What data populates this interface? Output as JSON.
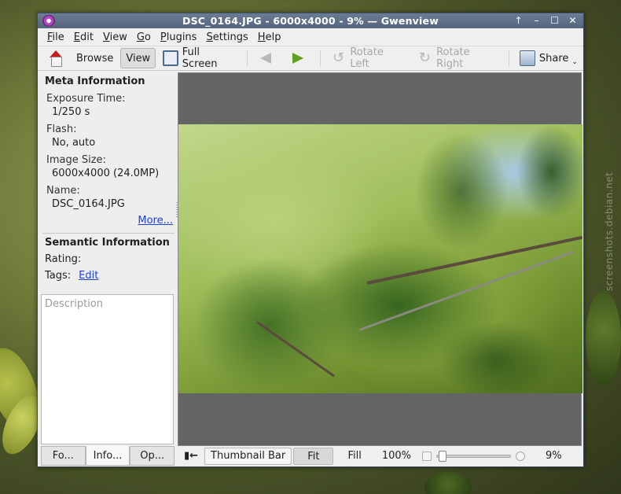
{
  "window": {
    "title": "DSC_0164.JPG - 6000x4000 - 9%  — Gwenview"
  },
  "menubar": {
    "items": [
      {
        "u": "F",
        "rest": "ile"
      },
      {
        "u": "E",
        "rest": "dit"
      },
      {
        "u": "V",
        "rest": "iew"
      },
      {
        "u": "G",
        "rest": "o"
      },
      {
        "u": "P",
        "rest": "lugins"
      },
      {
        "u": "S",
        "rest": "ettings"
      },
      {
        "u": "H",
        "rest": "elp"
      }
    ]
  },
  "toolbar": {
    "browse": "Browse",
    "view": "View",
    "full_screen": "Full Screen",
    "rotate_left": "Rotate Left",
    "rotate_right": "Rotate Right",
    "share": "Share"
  },
  "sidebar": {
    "meta_title": "Meta Information",
    "exposure_label": "Exposure Time:",
    "exposure_value": "1/250 s",
    "flash_label": "Flash:",
    "flash_value": "No, auto",
    "size_label": "Image Size:",
    "size_value": "6000x4000 (24.0MP)",
    "name_label": "Name:",
    "name_value": "DSC_0164.JPG",
    "more": "More...",
    "semantic_title": "Semantic Information",
    "rating_label": "Rating:",
    "tags_label": "Tags:",
    "tags_edit": "Edit",
    "description_placeholder": "Description",
    "tabs": [
      "Fo...",
      "Info...",
      "Op..."
    ]
  },
  "statusbar": {
    "thumbnail_bar": "Thumbnail Bar",
    "fit": "Fit",
    "fill": "Fill",
    "hundred": "100%",
    "zoom_value": "9%",
    "zoom_fraction": 0.03
  },
  "desktop": {
    "watermark": "screenshots.debian.net"
  },
  "colors": {
    "titlebar": "#5f6f88",
    "link": "#1a3fd6",
    "viewer_bg": "#646464"
  }
}
